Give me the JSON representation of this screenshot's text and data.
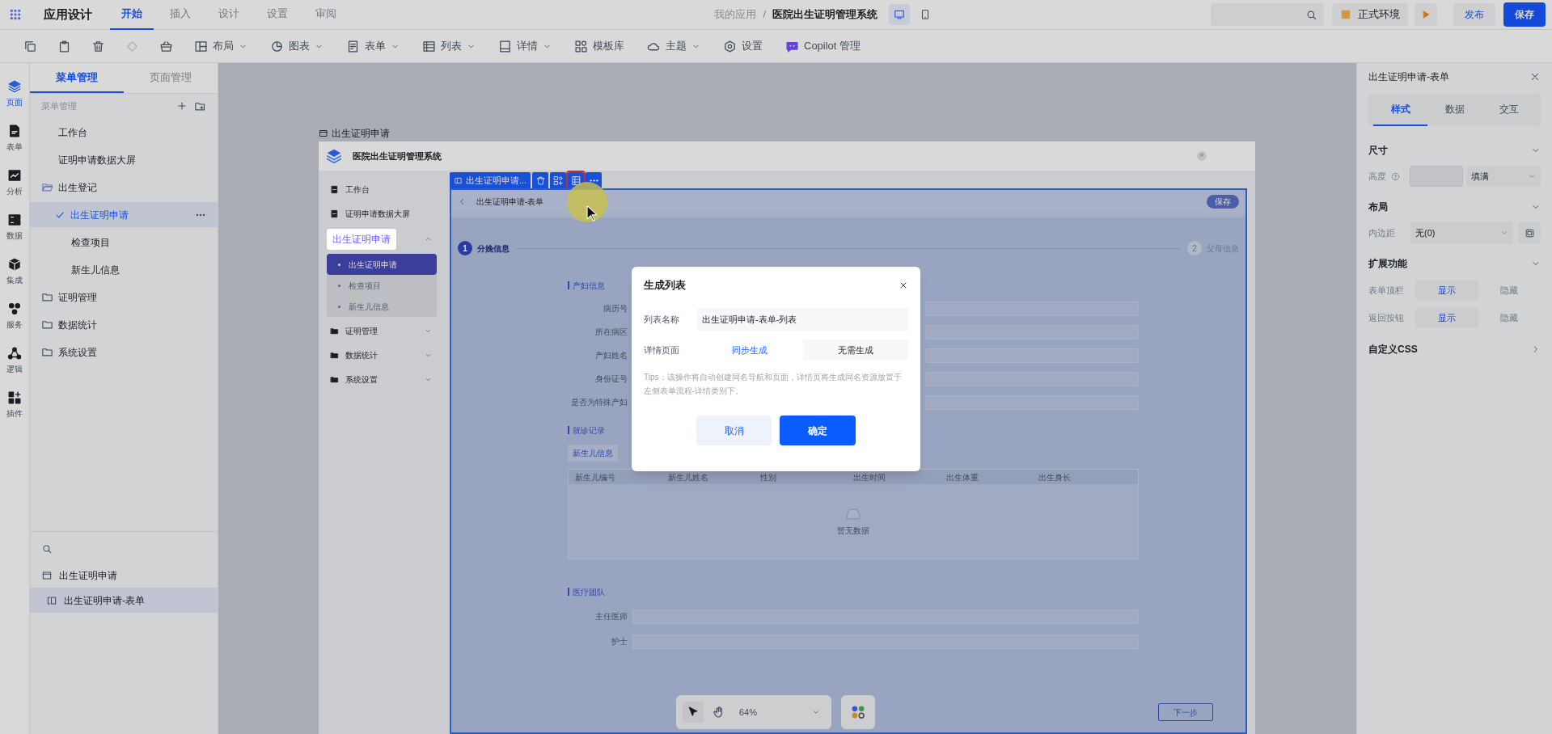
{
  "top_bar": {
    "app_title": "应用设计",
    "tabs": [
      {
        "label": "开始",
        "selected": true
      },
      {
        "label": "插入",
        "selected": false
      },
      {
        "label": "设计",
        "selected": false
      },
      {
        "label": "设置",
        "selected": false
      },
      {
        "label": "审阅",
        "selected": false
      }
    ],
    "breadcrumb": [
      {
        "label": "我的应用"
      },
      {
        "label": "医院出生证明管理系统"
      }
    ],
    "breadcrumb_separator": "/",
    "device_modes": [
      {
        "kind": "desktop",
        "selected": true
      },
      {
        "kind": "tablet",
        "selected": false
      }
    ],
    "env_button": "正式环境",
    "publish_button": "发布",
    "save_button": "保存"
  },
  "toolbar": [
    {
      "kind": "copy",
      "disabled": false
    },
    {
      "kind": "paste",
      "disabled": false
    },
    {
      "kind": "delete",
      "disabled": false
    },
    {
      "kind": "eraser",
      "disabled": true
    },
    {
      "kind": "basket",
      "disabled": false
    },
    {
      "kind": "layout",
      "label": "布局",
      "dropdown": true,
      "disabled": false
    },
    {
      "kind": "chart",
      "label": "图表",
      "dropdown": true,
      "disabled": false
    },
    {
      "kind": "form",
      "label": "表单",
      "dropdown": true,
      "disabled": false
    },
    {
      "kind": "list",
      "label": "列表",
      "dropdown": true,
      "disabled": false
    },
    {
      "kind": "detail",
      "label": "详情",
      "dropdown": true,
      "disabled": false
    },
    {
      "kind": "template",
      "label": "模板库",
      "dropdown": false,
      "disabled": false
    },
    {
      "kind": "theme",
      "label": "主题",
      "dropdown": true,
      "disabled": false
    },
    {
      "kind": "settings",
      "label": "设置",
      "dropdown": false,
      "disabled": false
    },
    {
      "kind": "copilot",
      "label": "Copilot 管理",
      "dropdown": false,
      "disabled": false
    }
  ],
  "icon_rail": [
    {
      "kind": "layers",
      "label": "页面",
      "selected": true
    },
    {
      "kind": "document",
      "label": "表单",
      "selected": false
    },
    {
      "kind": "chart",
      "label": "分析",
      "selected": false
    },
    {
      "kind": "server",
      "label": "数据",
      "selected": false
    },
    {
      "kind": "cube",
      "label": "集成",
      "selected": false
    },
    {
      "kind": "dots",
      "label": "服务",
      "selected": false
    },
    {
      "kind": "network",
      "label": "逻辑",
      "selected": false
    },
    {
      "kind": "plugin",
      "label": "插件",
      "selected": false
    }
  ],
  "left_panel": {
    "tabs": [
      {
        "label": "菜单管理",
        "selected": true
      },
      {
        "label": "页面管理",
        "selected": false
      }
    ],
    "section_title": "菜单管理",
    "menu": [
      {
        "kind": "page",
        "label": "工作台",
        "selected": false
      },
      {
        "kind": "page",
        "label": "证明申请数据大屏",
        "selected": false
      },
      {
        "kind": "folder",
        "label": "出生登记",
        "selected": false,
        "expanded": true,
        "children": [
          {
            "label": "出生证明申请",
            "selected": true
          },
          {
            "label": "检查项目",
            "selected": false
          },
          {
            "label": "新生儿信息",
            "selected": false
          }
        ]
      },
      {
        "kind": "folder",
        "label": "证明管理",
        "selected": false,
        "expanded": false
      },
      {
        "kind": "folder",
        "label": "数据统计",
        "selected": false,
        "expanded": false
      },
      {
        "kind": "folder",
        "label": "系统设置",
        "selected": false,
        "expanded": false
      }
    ],
    "component_tree": [
      {
        "kind": "page",
        "label": "出生证明申请",
        "selected": false,
        "children": [
          {
            "kind": "form",
            "label": "出生证明申请-表单",
            "selected": true
          }
        ]
      }
    ]
  },
  "canvas": {
    "page_label": "出生证明申请",
    "preview": {
      "system_title": "医院出生证明管理系统",
      "nav": [
        {
          "kind": "page",
          "label": "工作台"
        },
        {
          "kind": "page",
          "label": "证明申请数据大屏"
        },
        {
          "kind": "group",
          "label": "出生证明申请",
          "expanded": true,
          "children": [
            {
              "label": "出生证明申请",
              "selected": true
            },
            {
              "label": "检查项目",
              "selected": false
            },
            {
              "label": "新生儿信息",
              "selected": false
            }
          ]
        },
        {
          "kind": "folder",
          "label": "证明管理",
          "expanded": false
        },
        {
          "kind": "folder",
          "label": "数据统计",
          "expanded": false
        },
        {
          "kind": "folder",
          "label": "系统设置",
          "expanded": false
        }
      ],
      "selection_label": "出生证明申请...",
      "form_title": "出生证明申请-表单",
      "form_save": "保存",
      "steps": [
        {
          "number": "1",
          "label": "分娩信息",
          "selected": true
        },
        {
          "number": "2",
          "label": "父母信息",
          "selected": false
        }
      ],
      "maternal_section": {
        "title": "产妇信息",
        "fields": [
          {
            "label": "病历号"
          },
          {
            "label": "所在病区"
          },
          {
            "label": "产妇姓名"
          },
          {
            "label": "身份证号"
          },
          {
            "label": "是否为特殊产妇"
          }
        ]
      },
      "visit_section": {
        "title": "就诊记录",
        "tabs": [
          {
            "label": "新生儿信息",
            "selected": true
          }
        ],
        "columns": [
          "新生儿编号",
          "新生儿姓名",
          "性别",
          "出生时间",
          "出生体重",
          "出生身长"
        ],
        "empty_text": "暂无数据"
      },
      "team_section": {
        "title": "医疗团队",
        "fields": [
          {
            "label": "主任医师"
          },
          {
            "label": "护士"
          }
        ]
      },
      "next_button": "下一步"
    },
    "tools": [
      {
        "kind": "pointer",
        "selected": true
      },
      {
        "kind": "hand",
        "selected": false
      }
    ],
    "zoom": "64%"
  },
  "dialog": {
    "title": "生成列表",
    "list_name": {
      "label": "列表名称",
      "value": "出生证明申请-表单-列表"
    },
    "detail_page": {
      "label": "详情页面",
      "options": [
        {
          "label": "同步生成",
          "selected": true
        },
        {
          "label": "无需生成",
          "selected": false
        }
      ]
    },
    "tips": "Tips：该操作将自动创建同名导航和页面，详情页将生成同名资源放置于左侧表单流程-详情类别下。",
    "cancel_button": "取消",
    "ok_button": "确定"
  },
  "right_panel": {
    "title": "出生证明申请-表单",
    "tabs": [
      {
        "label": "样式",
        "selected": true
      },
      {
        "label": "数据",
        "selected": false
      },
      {
        "label": "交互",
        "selected": false
      }
    ],
    "size_section": {
      "title": "尺寸",
      "expanded": true,
      "height_label": "高度",
      "height_mode": "填满"
    },
    "layout_section": {
      "title": "布局",
      "expanded": true,
      "padding_label": "内边距",
      "padding_value": "无(0)"
    },
    "extend_section": {
      "title": "扩展功能",
      "expanded": true,
      "rows": [
        {
          "label": "表单顶栏",
          "options": [
            {
              "label": "显示",
              "selected": true
            },
            {
              "label": "隐藏",
              "selected": false
            }
          ]
        },
        {
          "label": "返回按钮",
          "options": [
            {
              "label": "显示",
              "selected": true
            },
            {
              "label": "隐藏",
              "selected": false
            }
          ]
        }
      ]
    },
    "css_section": {
      "title": "自定义CSS",
      "expanded": false
    }
  }
}
